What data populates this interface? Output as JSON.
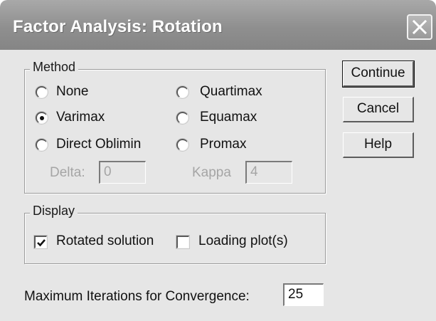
{
  "window": {
    "title": "Factor Analysis: Rotation"
  },
  "method": {
    "legend": "Method",
    "options": [
      {
        "label": "None",
        "selected": false
      },
      {
        "label": "Quartimax",
        "selected": false
      },
      {
        "label": "Varimax",
        "selected": true
      },
      {
        "label": "Equamax",
        "selected": false
      },
      {
        "label": "Direct Oblimin",
        "selected": false
      },
      {
        "label": "Promax",
        "selected": false
      }
    ],
    "delta": {
      "label": "Delta:",
      "value": "0",
      "enabled": false
    },
    "kappa": {
      "label": "Kappa",
      "value": "4",
      "enabled": false
    }
  },
  "display": {
    "legend": "Display",
    "rotated_solution": {
      "label": "Rotated solution",
      "checked": true
    },
    "loading_plots": {
      "label": "Loading plot(s)",
      "checked": false
    }
  },
  "iterations": {
    "label": "Maximum Iterations for Convergence:",
    "value": "25"
  },
  "buttons": {
    "continue": "Continue",
    "cancel": "Cancel",
    "help": "Help"
  },
  "icons": {
    "close": "close-icon",
    "check": "checkmark-icon"
  }
}
